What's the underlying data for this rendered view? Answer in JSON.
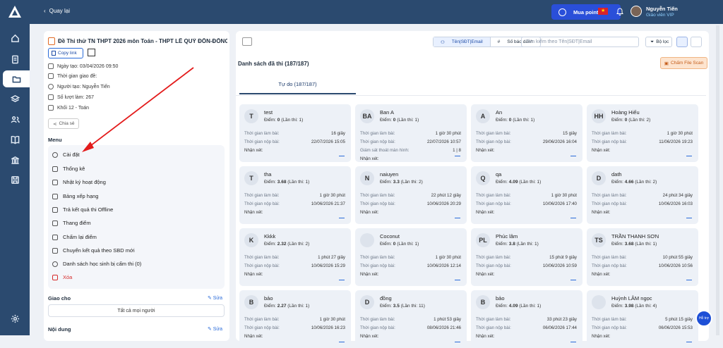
{
  "nav": {
    "back_label": "Quay lại"
  },
  "topbar": {
    "buy_points": "Mua point",
    "user_name": "Nguyễn Tiến",
    "user_role": "Giáo viên VIP"
  },
  "exam": {
    "title": "Đề Thi thử TN THPT 2026 môn Toán - THPT LÊ QUÝ ĐÔN-ĐỐNG ...",
    "copy_link": "Copy link",
    "created": "Ngày tạo: 03/04/2026 09:50",
    "assigned": "Thời gian giao đề:",
    "creator": "Người tạo: Nguyễn Tiến",
    "attempts": "Số lượt làm: 267",
    "grade": "Khối 12 - Toán",
    "share": "Chia sẻ"
  },
  "menu": {
    "header": "Menu",
    "items": [
      "Cài đặt",
      "Thống kê",
      "Nhật ký hoạt động",
      "Bảng xếp hạng",
      "Trả kết quả thi Offline",
      "Thang điểm",
      "Chấm lại điểm",
      "Chuyển kết quả theo SBD mới",
      "Danh sách học sinh bị cấm thi (0)",
      "Xóa"
    ]
  },
  "assign": {
    "header": "Giao cho",
    "edit": "Sửa",
    "all": "Tất cả mọi người"
  },
  "content": {
    "header": "Nội dung",
    "edit": "Sửa"
  },
  "toolbar": {
    "seg_name": "Tên|SĐT|Email",
    "seg_sbd": "Số báo danh",
    "search_placeholder": "Tìm kiếm theo Tên|SĐT|Email",
    "filter": "Bộ lọc"
  },
  "list": {
    "title": "Danh sách đã thi (187/187)",
    "scan": "Chấm File Scan",
    "tab": "Tự do (187/187)"
  },
  "labels": {
    "time_spent": "Thời gian làm bài:",
    "submit_time": "Thời gian nộp bài:",
    "monitor": "Giám sát thoát màn hình:",
    "comment": "Nhận xét:"
  },
  "cards": [
    {
      "initials": "T",
      "name": "test",
      "score": "0",
      "attempt": "(Lần thi: 1)",
      "spent": "16 giây",
      "submit": "22/07/2026 15:05"
    },
    {
      "initials": "BA",
      "name": "Ban A",
      "score": "0",
      "attempt": "(Lần thi: 1)",
      "spent": "1 giờ 30 phút",
      "submit": "22/07/2026 10:57",
      "monitor": "1 | 8"
    },
    {
      "initials": "A",
      "name": "An",
      "score": "0",
      "attempt": "(Lần thi: 1)",
      "spent": "15 giây",
      "submit": "29/06/2026 16:04"
    },
    {
      "initials": "HH",
      "name": "Hoàng Hiếu",
      "score": "0",
      "attempt": "(Lần thi: 2)",
      "spent": "1 giờ 30 phút",
      "submit": "11/06/2026 19:23"
    },
    {
      "initials": "T",
      "name": "tha",
      "score": "3.68",
      "attempt": "(Lần thi: 1)",
      "spent": "1 giờ 30 phút",
      "submit": "10/06/2026 21:37"
    },
    {
      "initials": "N",
      "name": "naiuyen",
      "score": "3.3",
      "attempt": "(Lần thi: 2)",
      "spent": "22 phút 12 giây",
      "submit": "10/06/2026 20:29"
    },
    {
      "initials": "Q",
      "name": "qa",
      "score": "4.09",
      "attempt": "(Lần thi: 1)",
      "spent": "1 giờ 30 phút",
      "submit": "10/06/2026 17:40"
    },
    {
      "initials": "D",
      "name": "dath",
      "score": "4.66",
      "attempt": "(Lần thi: 2)",
      "spent": "24 phút 34 giây",
      "submit": "10/06/2026 16:03"
    },
    {
      "initials": "K",
      "name": "Kkkk",
      "score": "2.32",
      "attempt": "(Lần thi: 2)",
      "spent": "1 phút 27 giây",
      "submit": "10/06/2026 15:29"
    },
    {
      "initials": "",
      "name": "Coconut",
      "score": "0",
      "attempt": "(Lần thi: 1)",
      "spent": "1 giờ 30 phút",
      "submit": "10/06/2026 12:14"
    },
    {
      "initials": "PL",
      "name": "Phúc lâm",
      "score": "3.8",
      "attempt": "(Lần thi: 1)",
      "spent": "15 phút 9 giây",
      "submit": "10/06/2026 10:59"
    },
    {
      "initials": "TS",
      "name": "TRẦN THANH SƠN",
      "score": "3.68",
      "attempt": "(Lần thi: 1)",
      "spent": "10 phút 55 giây",
      "submit": "10/06/2026 10:56"
    },
    {
      "initials": "B",
      "name": "bảo",
      "score": "2.27",
      "attempt": "(Lần thi: 1)",
      "spent": "1 giờ 30 phút",
      "submit": "10/06/2026 16:23"
    },
    {
      "initials": "D",
      "name": "đồng",
      "score": "3.5",
      "attempt": "(Lần thi: 11)",
      "spent": "1 phút 53 giây",
      "submit": "08/06/2026 21:46"
    },
    {
      "initials": "B",
      "name": "bảo",
      "score": "4.09",
      "attempt": "(Lần thi: 1)",
      "spent": "33 phút 23 giây",
      "submit": "06/06/2026 17:44"
    },
    {
      "initials": "",
      "name": "Huỳnh LÂM ngọc",
      "score": "3.98",
      "attempt": "(Lần thi: 4)",
      "spent": "5 phút 15 giây",
      "submit": "06/06/2026 15:53"
    }
  ],
  "score_label": "Điểm:",
  "chat_label": "Hỗ trợ"
}
